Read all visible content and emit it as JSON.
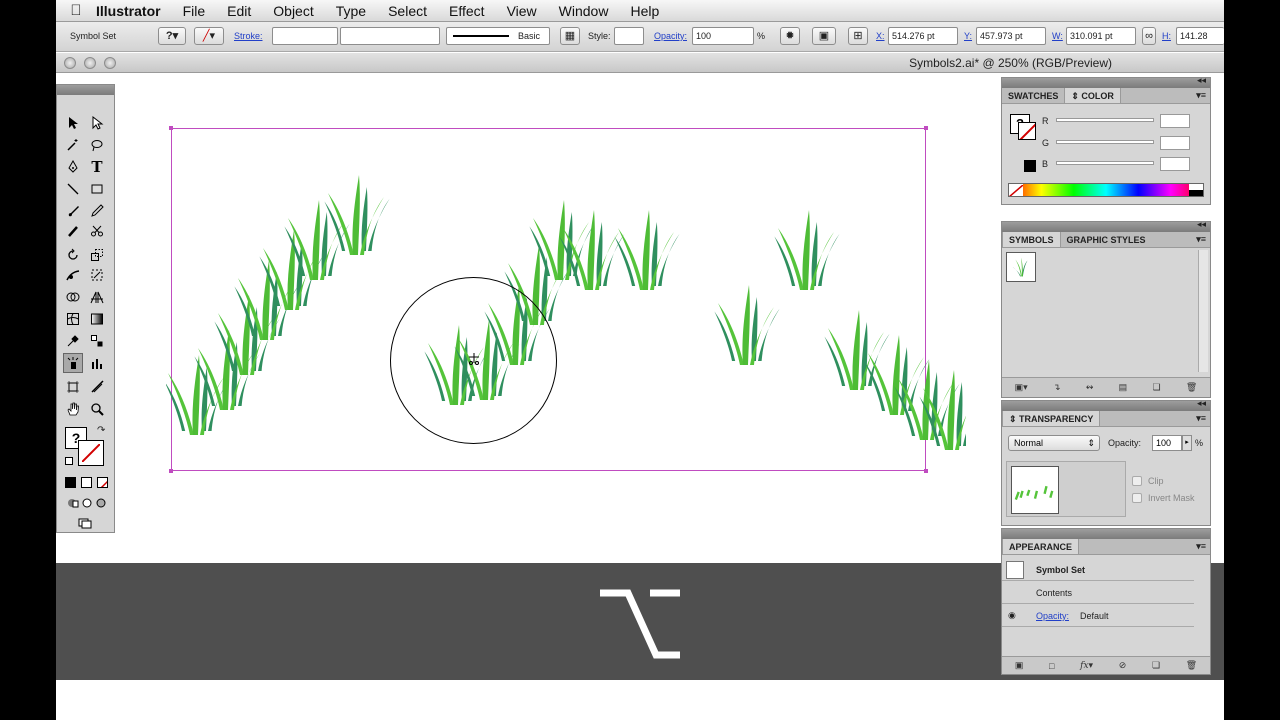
{
  "menubar": {
    "app_name": "Illustrator",
    "items": [
      "File",
      "Edit",
      "Object",
      "Type",
      "Select",
      "Effect",
      "View",
      "Window",
      "Help"
    ]
  },
  "controlbar": {
    "selection_label": "Symbol Set",
    "stroke_label": "Stroke:",
    "brush_label": "Basic",
    "style_label": "Style:",
    "opacity_label": "Opacity:",
    "opacity_value": "100",
    "percent": "%",
    "x_label": "X:",
    "x_value": "514.276 pt",
    "y_label": "Y:",
    "y_value": "457.973 pt",
    "w_label": "W:",
    "w_value": "310.091 pt",
    "h_label": "H:",
    "h_value": "141.28"
  },
  "window": {
    "title": "Symbols2.ai* @ 250% (RGB/Preview)"
  },
  "overlay": {
    "key_symbol": "option-key-icon"
  },
  "color_panel": {
    "tabs": [
      "SWATCHES",
      "COLOR"
    ],
    "active_tab": "COLOR",
    "channels": [
      "R",
      "G",
      "B"
    ]
  },
  "symbols_panel": {
    "tabs": [
      "SYMBOLS",
      "GRAPHIC STYLES"
    ],
    "active_tab": "SYMBOLS"
  },
  "transparency_panel": {
    "title": "TRANSPARENCY",
    "blend_mode": "Normal",
    "opacity_label": "Opacity:",
    "opacity_value": "100",
    "percent": "%",
    "clip_label": "Clip",
    "invert_mask_label": "Invert Mask"
  },
  "appearance_panel": {
    "title": "APPEARANCE",
    "object_name": "Symbol Set",
    "contents_label": "Contents",
    "opacity_link": "Opacity:",
    "opacity_value": "Default"
  },
  "colors": {
    "grass_light": "#55c43a",
    "grass_dark": "#2f8f5e",
    "selection": "#c04cc0",
    "overlay": "#3c3c3c"
  }
}
